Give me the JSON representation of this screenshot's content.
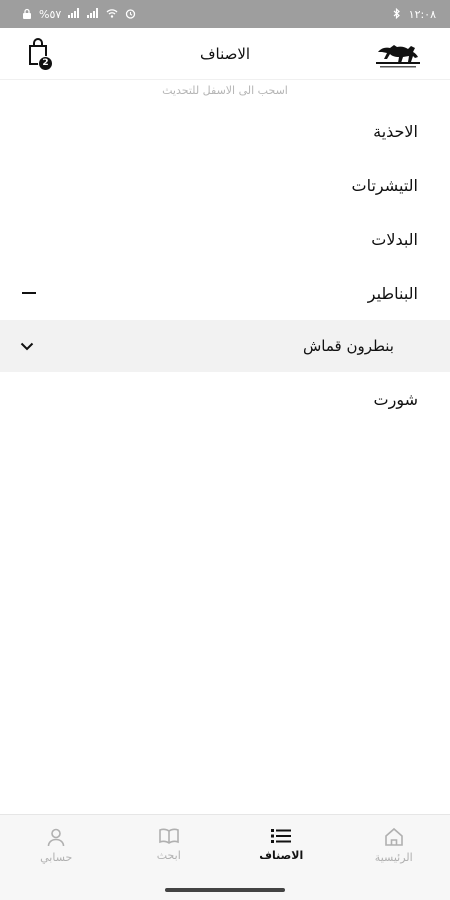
{
  "status_bar": {
    "time": "١٢:٠٨",
    "battery": "%٥٧"
  },
  "header": {
    "title": "الاصناف",
    "cart_count": "2"
  },
  "pull_hint": "اسحب الى الاسفل للتحديث",
  "categories": [
    {
      "label": "الاحذية"
    },
    {
      "label": "التيشرتات"
    },
    {
      "label": "البدلات"
    },
    {
      "label": "البناطير",
      "expanded": true
    }
  ],
  "subcategory": {
    "label": "بنطرون قماش"
  },
  "categories_after": [
    {
      "label": "شورت"
    }
  ],
  "bottom_nav": {
    "items": [
      {
        "label": "حسابي",
        "icon": "user-icon"
      },
      {
        "label": "ابحث",
        "icon": "book-icon"
      },
      {
        "label": "الاصناف",
        "icon": "list-icon",
        "active": true
      },
      {
        "label": "الرئيسية",
        "icon": "home-icon"
      }
    ]
  },
  "colors": {
    "status_bar_bg": "#9e9e9e",
    "subcategory_bg": "#f2f2f2",
    "nav_bg": "#f7f7f7",
    "active": "#111111",
    "inactive": "#b0b0b0"
  }
}
